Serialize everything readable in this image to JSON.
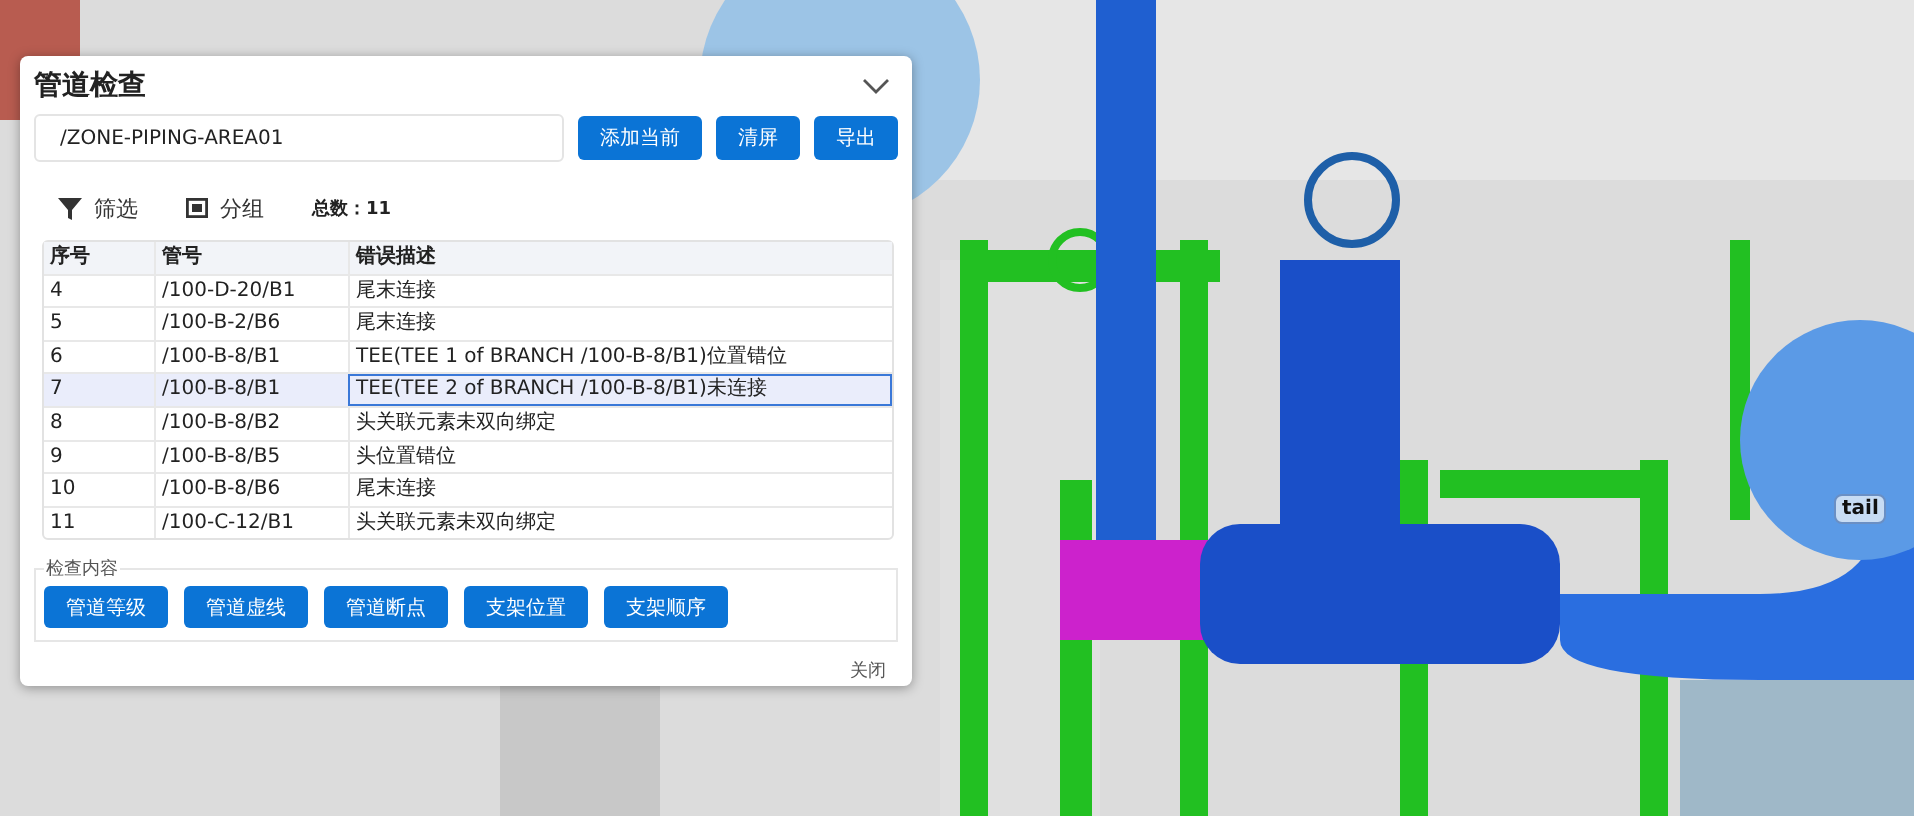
{
  "panel": {
    "title": "管道检查",
    "path_field": {
      "value": "/ZONE-PIPING-AREA01"
    },
    "buttons": [
      "添加当前",
      "清屏",
      "导出"
    ],
    "toolbar": {
      "filter": "筛选",
      "group": "分组",
      "total_label": "总数：",
      "total": "11"
    },
    "table": {
      "columns": [
        "序号",
        "管号",
        "错误描述"
      ],
      "rows": [
        {
          "cells": [
            "4",
            "/100-D-20/B1",
            "尾末连接"
          ],
          "selected": false
        },
        {
          "cells": [
            "5",
            "/100-B-2/B6",
            "尾末连接"
          ],
          "selected": false
        },
        {
          "cells": [
            "6",
            "/100-B-8/B1",
            "TEE(TEE 1 of BRANCH /100-B-8/B1)位置错位"
          ],
          "selected": false
        },
        {
          "cells": [
            "7",
            "/100-B-8/B1",
            "TEE(TEE 2 of BRANCH /100-B-8/B1)未连接"
          ],
          "selected": true
        },
        {
          "cells": [
            "8",
            "/100-B-8/B2",
            "头关联元素未双向绑定"
          ],
          "selected": false
        },
        {
          "cells": [
            "9",
            "/100-B-8/B5",
            "头位置错位"
          ],
          "selected": false
        },
        {
          "cells": [
            "10",
            "/100-B-8/B6",
            "尾末连接"
          ],
          "selected": false
        },
        {
          "cells": [
            "11",
            "/100-C-12/B1",
            "头关联元素未双向绑定"
          ],
          "selected": false
        }
      ]
    },
    "check_group": {
      "legend": "检查内容",
      "buttons": [
        "管道等级",
        "管道虚线",
        "管道断点",
        "支架位置",
        "支架顺序"
      ]
    },
    "close": "关闭"
  },
  "scene": {
    "tag": "tail"
  }
}
